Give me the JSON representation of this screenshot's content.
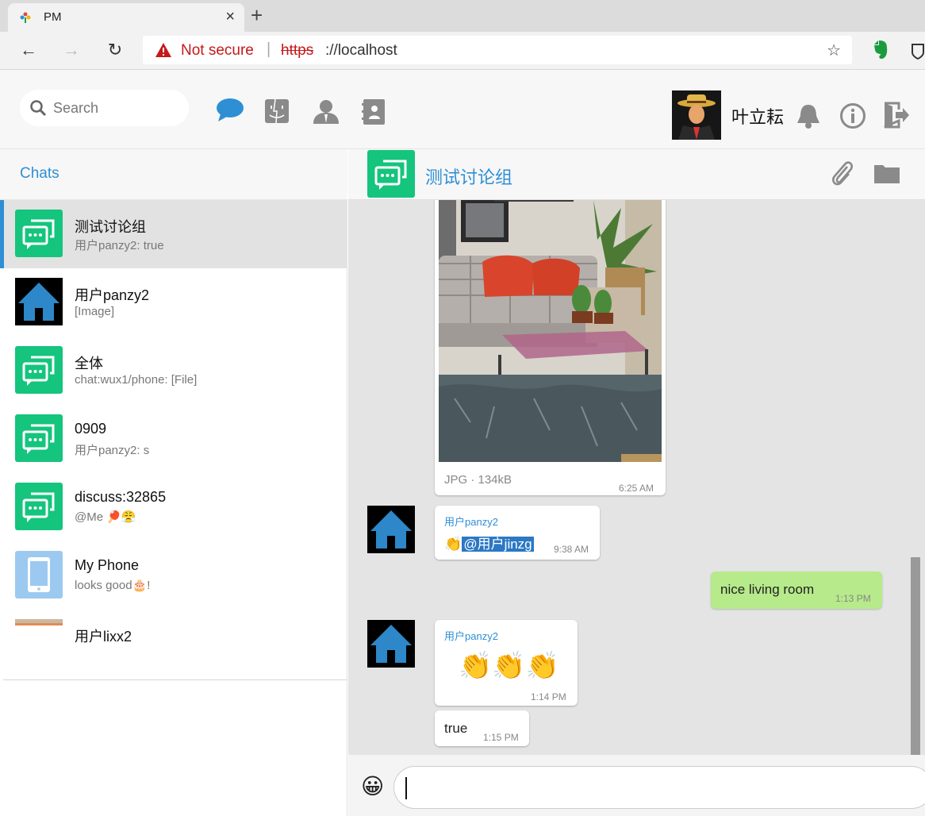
{
  "browser": {
    "tab_title": "PM",
    "tab_close": "×",
    "new_tab": "+",
    "not_secure": "Not secure",
    "url_protocol": "https",
    "url_host": "://localhost",
    "back": "←",
    "forward": "→",
    "reload": "↻",
    "star": "☆"
  },
  "header": {
    "search_placeholder": "Search",
    "user_name": "叶立耘",
    "icons": [
      "chat-icon",
      "finder-face-icon",
      "contacts-icon",
      "address-book-icon",
      "bell-icon",
      "info-icon",
      "logout-icon"
    ]
  },
  "sidebar": {
    "title": "Chats",
    "items": [
      {
        "name": "测试讨论组",
        "preview": "用户panzy2: true",
        "avatar": "group-chat-icon",
        "active": true
      },
      {
        "name": "用户panzy2",
        "preview": "[Image]",
        "avatar": "house-icon"
      },
      {
        "name": "全体",
        "preview": "chat:wux1/phone: [File]",
        "avatar": "group-chat-icon"
      },
      {
        "name": "0909",
        "preview": "用户panzy2: s",
        "avatar": "group-chat-icon"
      },
      {
        "name": "discuss:32865",
        "preview": "@Me 🏓😤",
        "avatar": "group-chat-icon"
      },
      {
        "name": "My Phone",
        "preview": "looks good🎂!",
        "avatar": "phone-icon"
      },
      {
        "name": "用户lixx2",
        "preview": "",
        "avatar": "photo-avatar"
      }
    ]
  },
  "conversation": {
    "title": "测试讨论组",
    "messages": [
      {
        "type": "image",
        "meta": "JPG · 134kB",
        "time": "6:25 AM"
      },
      {
        "type": "text",
        "sender": "用户panzy2",
        "prefix": "👏",
        "mention": "@用户jinzg",
        "time": "9:38 AM"
      },
      {
        "type": "outgoing",
        "text": "nice living room",
        "time": "1:13 PM"
      },
      {
        "type": "text",
        "sender": "用户panzy2",
        "text": "👏👏👏",
        "time": "1:14 PM"
      },
      {
        "type": "text",
        "text": "true",
        "time": "1:15 PM"
      }
    ],
    "emoji_button": "😀"
  },
  "colors": {
    "accent": "#2e8fd4",
    "group_green": "#15c47d",
    "outgoing_bubble": "#b6ea8a"
  }
}
